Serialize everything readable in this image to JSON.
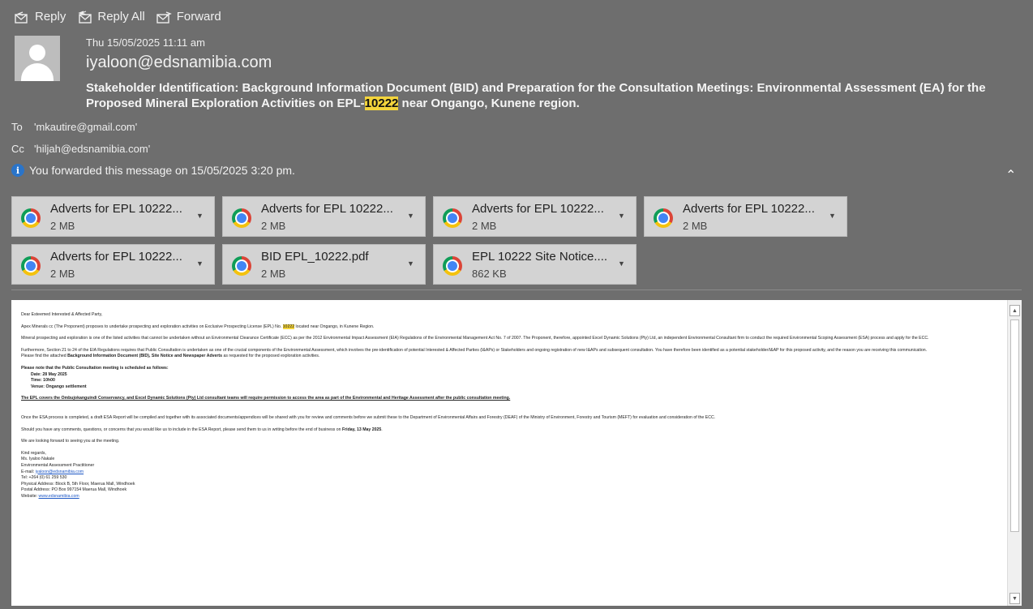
{
  "toolbar": {
    "reply": "Reply",
    "reply_all": "Reply All",
    "forward": "Forward"
  },
  "header": {
    "date": "Thu 15/05/2025 11:11 am",
    "sender": "iyaloon@edsnamibia.com",
    "subject_prefix": "Stakeholder Identification:  Background Information Document (BID) and Preparation for the Consultation Meetings: Environmental Assessment (EA) for the Proposed Mineral Exploration Activities on EPL-",
    "subject_highlight": "10222",
    "subject_suffix": " near Ongango, Kunene region.",
    "to_label": "To",
    "to_value": "'mkautire@gmail.com'",
    "cc_label": "Cc",
    "cc_value": "'hiljah@edsnamibia.com'",
    "notice": "You forwarded this message on 15/05/2025 3:20 pm."
  },
  "attachments": [
    {
      "name": "Adverts for EPL 10222...",
      "size": "2 MB"
    },
    {
      "name": "Adverts for EPL 10222...",
      "size": "2 MB"
    },
    {
      "name": "Adverts for EPL 10222...",
      "size": "2 MB"
    },
    {
      "name": "Adverts for EPL 10222...",
      "size": "2 MB"
    },
    {
      "name": "Adverts for EPL 10222...",
      "size": "2 MB"
    },
    {
      "name": "BID EPL_10222.pdf",
      "size": "2 MB"
    },
    {
      "name": "EPL 10222 Site Notice....",
      "size": "862 KB"
    }
  ],
  "body": {
    "greeting": "Dear Esteemed Interested & Affected Party,",
    "p1_pre": "Apex Minerals cc (The Proponent) proposes to undertake prospecting and exploration activities on Exclusive Prospecting License (EPL) No. ",
    "p1_hl": "10222",
    "p1_post": " located near Ongango, in Kunene Region.",
    "p2": "Mineral prospecting and exploration is one of the listed activities that cannot be undertaken without an Environmental Clearance Certificate (ECC) as per the 2012 Environmental Impact Assessment (EIA) Regulations of the Environmental Management Act No. 7 of 2007. The Proponent, therefore, appointed Excel Dynamic Solutions (Pty) Ltd, an independent Environmental Consultant firm to conduct the required Environmental Scoping Assessment (ESA) process and apply for the ECC.",
    "p3": "Furthermore, Section 21 to 24 of the EIA Regulations requires that Public Consultation is undertaken as one of the crucial components of the Environmental Assessment, which involves the pre-identification of potential Interested & Affected Parties (I&APs) or Stakeholders and ongoing registration of new I&APs and subsequent consultation. You have therefore been identified as a potential stakeholder/I&AP for this proposed activity, and the reason you are receiving this communication.",
    "p4_pre": "Please find the attached ",
    "p4_b": "Background Information Document (BID), Site Notice and Newspaper Adverts",
    "p4_post": " as requested for the proposed exploration activities.",
    "meeting_intro": "Please note that the Public Consultation meeting is scheduled as follows:",
    "meeting_date": "Date: 28 May 2025",
    "meeting_time": "Time: 10h00",
    "meeting_venue": "Venue: Ongango settlement",
    "p5": "The EPL covers the Ombujokanguindi Conservancy, and Excel Dynamic Solutions (Pty) Ltd consultant teams will require permission to access the area as part of the Environmental and Heritage Assessment after the public consultation meeting.",
    "p6": "Once the ESA process is completed, a draft ESA Report will be compiled and together with its associated documents/appendices will be shared with you for review and comments before we submit these to the Department of Environmental Affairs and Forestry (DEAF) of the Ministry of Environment, Forestry and Tourism (MEFT) for evaluation and consideration of the ECC.",
    "p7_pre": "Should you have any comments, questions, or concerns that you would like us to include in the ESA Report, please send them to us in writing before the end of business on ",
    "p7_b": "Friday, 13 May 2025",
    "p7_post": ".",
    "p8": "We are looking forward to seeing you at the meeting.",
    "sig_regards": "Kind regards,",
    "sig_name": "Ms. Iyaloo Nakale",
    "sig_title": "Environmental Assessment Practitioner",
    "sig_email_label": "E-mail: ",
    "sig_email": "iyaloon@edsnamibia.com",
    "sig_tel": "Tel: +264 (0) 61 259 530",
    "sig_physical": "Physical Address: Block B, 5th Floor, Maerua Mall, Windhoek",
    "sig_postal": "Postal Address: PO Box 997154 Maerua Mall, Windhoek",
    "sig_web_label": "Website: ",
    "sig_web": "www.edsnamibia.com"
  }
}
